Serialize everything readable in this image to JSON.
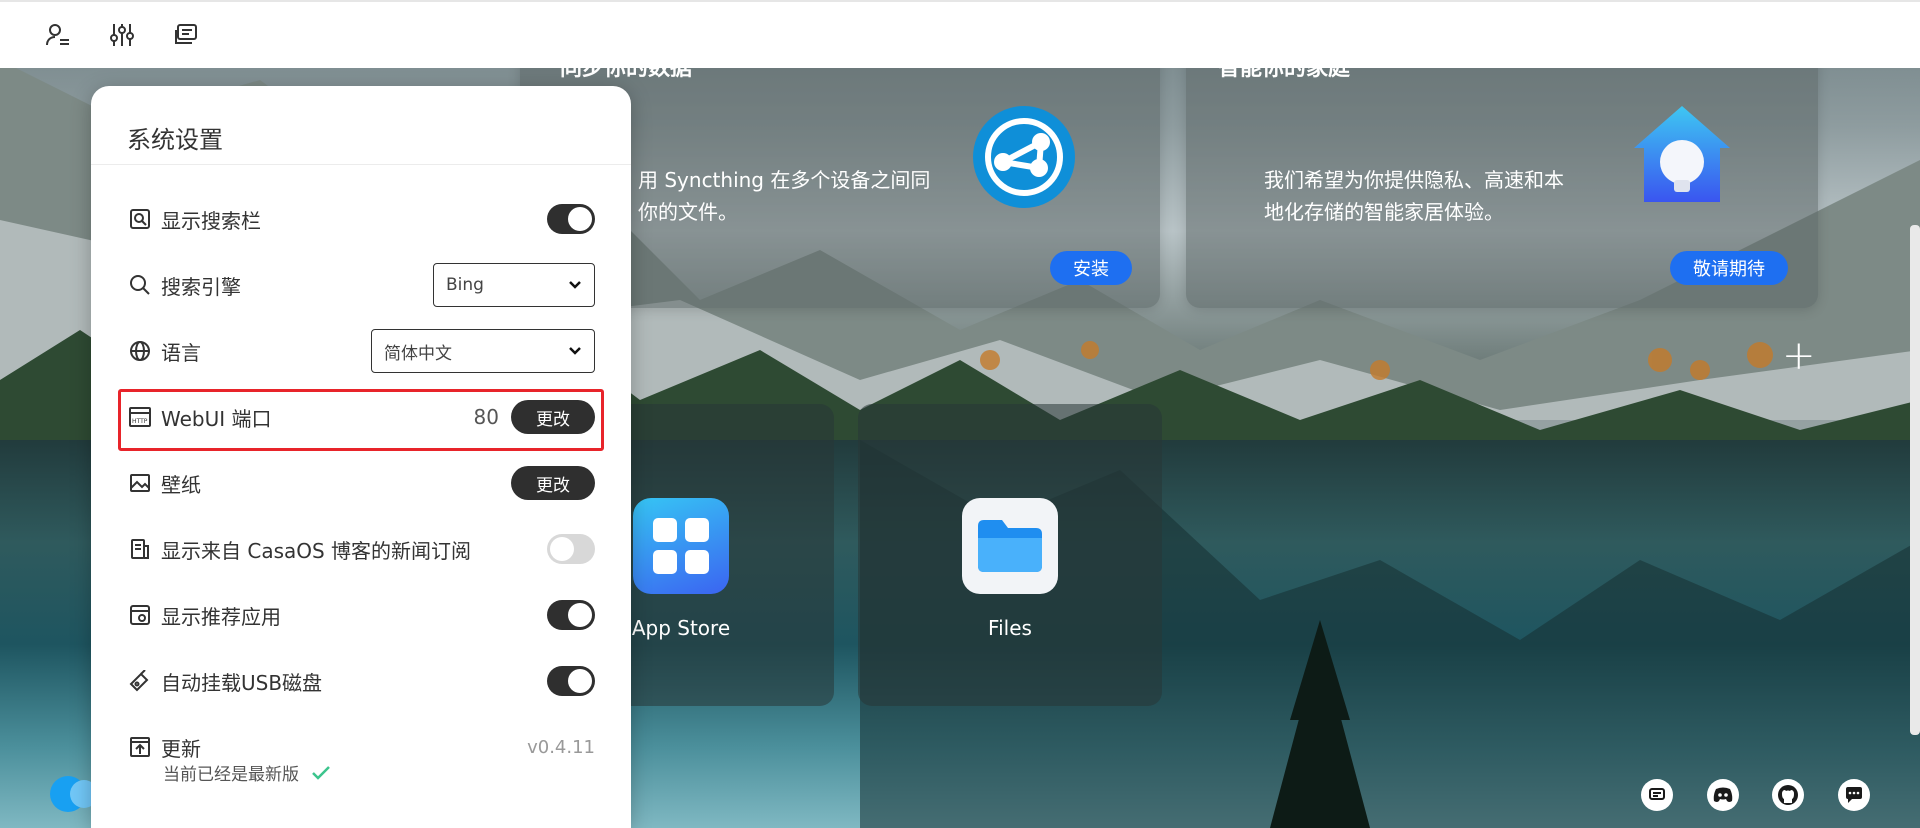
{
  "topbar": {
    "icons": [
      "user-settings-icon",
      "sliders-icon",
      "widgets-icon"
    ]
  },
  "settings": {
    "title": "系统设置",
    "rows": {
      "search_bar": {
        "label": "显示搜索栏",
        "enabled": true
      },
      "search_engine": {
        "label": "搜索引擎",
        "value": "Bing"
      },
      "language": {
        "label": "语言",
        "value": "简体中文"
      },
      "webui_port": {
        "label": "WebUI 端口",
        "value": "80",
        "button": "更改"
      },
      "wallpaper": {
        "label": "壁纸",
        "button": "更改"
      },
      "news_feed": {
        "label": "显示来自 CasaOS 博客的新闻订阅",
        "enabled": false
      },
      "recommended_apps": {
        "label": "显示推荐应用",
        "enabled": true
      },
      "auto_mount_usb": {
        "label": "自动挂载USB磁盘",
        "enabled": true
      },
      "update": {
        "label": "更新",
        "version": "v0.4.11",
        "status": "当前已经是最新版"
      }
    }
  },
  "cards": {
    "syncthing": {
      "title_partial": "同步你的数据",
      "desc_line1": "用 Syncthing 在多个设备之间同",
      "desc_line2": "你的文件。",
      "button": "安装"
    },
    "smart_home": {
      "title_partial": "智能你的家庭",
      "desc_line1": "我们希望为你提供隐私、高速和本",
      "desc_line2": "地化存储的智能家居体验。",
      "button": "敬请期待"
    }
  },
  "apps": [
    {
      "name": "App Store",
      "icon": "app-store-icon"
    },
    {
      "name": "Files",
      "icon": "folder-icon"
    }
  ],
  "add_label": "+",
  "footer_icons": [
    "message-icon",
    "discord-icon",
    "github-icon",
    "chat-icon"
  ],
  "colors": {
    "accent": "#1e6ff1",
    "highlight": "#e8242a",
    "toggle_on": "#2f2f2f"
  }
}
